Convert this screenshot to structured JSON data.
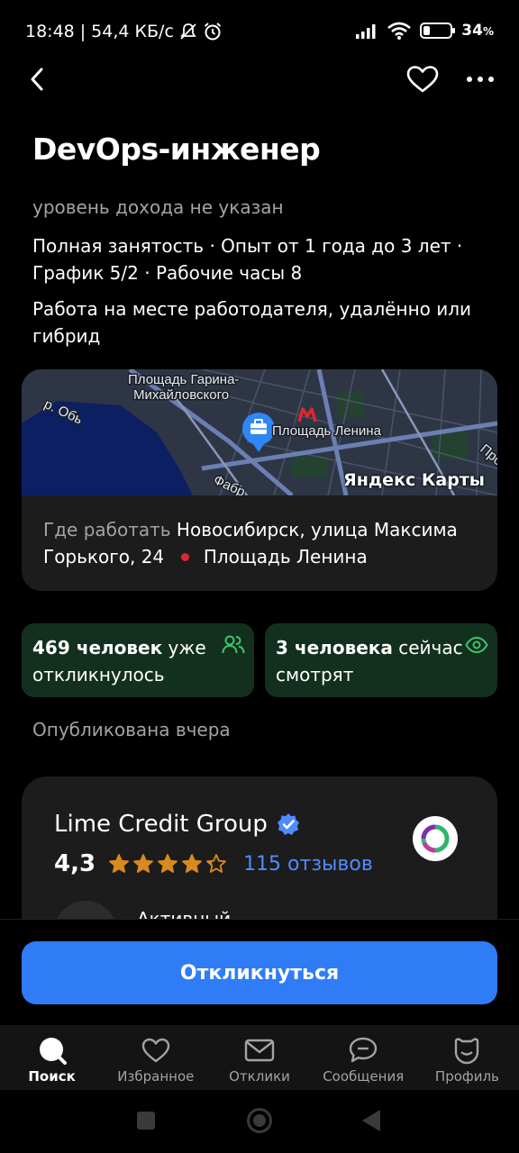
{
  "status_bar": {
    "time": "18:48",
    "network_speed": "54,4 КБ/с",
    "battery_percent": "34",
    "battery_unit": "%",
    "battery_level": 0.34,
    "icons": [
      "mute-icon",
      "alarm-icon",
      "signal-icon",
      "wifi-icon",
      "battery-icon"
    ]
  },
  "header": {
    "icons": [
      "back-icon",
      "heart-icon",
      "more-icon"
    ]
  },
  "vacancy": {
    "title": "DevOps-инженер",
    "salary": "уровень дохода не указан",
    "conditions": "Полная занятость · Опыт от 1 года до 3 лет · График 5/2 · Рабочие часы 8",
    "workplace": "Работа на месте работодателя, удалённо или гибрид"
  },
  "map": {
    "labels": {
      "area": "Площадь Гарина-Михайловского",
      "metro": "Площадь Ленина",
      "river": "р. Обь",
      "street": "Фабр",
      "street_right": "Про"
    },
    "brand": "Яндекс Карты",
    "address_label": "Где работать",
    "address": "Новосибирск, улица Максима Горького, 24",
    "metro_station": "Площадь Ленина",
    "metro_color": "#e0262f"
  },
  "stats": {
    "responded_strong": "469 человек",
    "responded_rest": " уже откликнулось",
    "viewing_strong": "3 человека",
    "viewing_rest": " сейчас смотрят"
  },
  "published": "Опубликована вчера",
  "company": {
    "name": "Lime Credit Group",
    "rating": "4,3",
    "rating_value": 4.3,
    "reviews": "115 отзывов",
    "activity": "Активный"
  },
  "apply_button": "Откликнуться",
  "tabbar": {
    "items": [
      {
        "label": "Поиск",
        "icon": "search-icon",
        "active": true
      },
      {
        "label": "Избранное",
        "icon": "heart-icon",
        "active": false
      },
      {
        "label": "Отклики",
        "icon": "mail-icon",
        "active": false
      },
      {
        "label": "Сообщения",
        "icon": "chat-icon",
        "active": false
      },
      {
        "label": "Профиль",
        "icon": "profile-icon",
        "active": false
      }
    ]
  },
  "colors": {
    "accent": "#2f7cf6",
    "stat_card": "#13301f",
    "stat_icon": "#3ec46d",
    "star": "#d98a1f",
    "link": "#4f8cff"
  }
}
